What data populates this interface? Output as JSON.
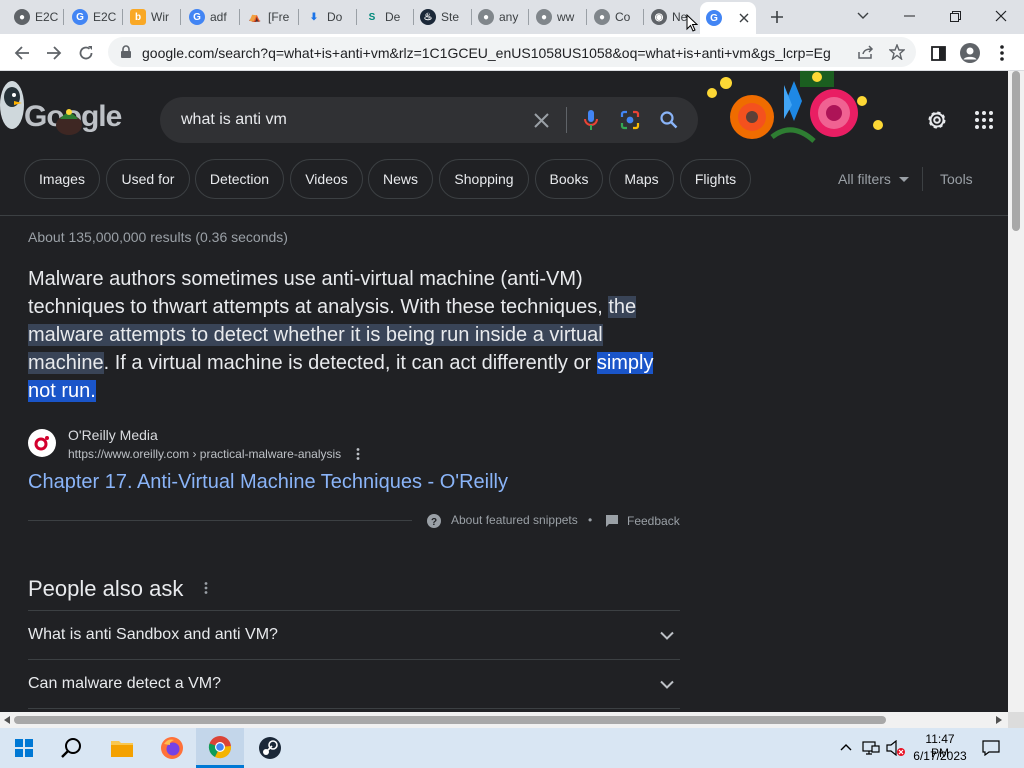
{
  "tabs": [
    {
      "label": "E2C",
      "color": "#5f6368"
    },
    {
      "label": "E2C",
      "color": "#4285f4"
    },
    {
      "label": "Wir",
      "color": "#f9a825"
    },
    {
      "label": "adf",
      "color": "#4285f4"
    },
    {
      "label": "[Fre",
      "color": "#202124"
    },
    {
      "label": "Do",
      "color": "#1a73e8"
    },
    {
      "label": "De",
      "color": "#00897b"
    },
    {
      "label": "Ste",
      "color": "#1b2838"
    },
    {
      "label": "any",
      "color": "#80868b"
    },
    {
      "label": "ww",
      "color": "#80868b"
    },
    {
      "label": "Co",
      "color": "#80868b"
    },
    {
      "label": "Ne",
      "color": "#5f6368"
    },
    {
      "label": "",
      "color": "#4285f4"
    }
  ],
  "browser": {
    "url": "google.com/search?q=what+is+anti+vm&rlz=1C1GCEU_enUS1058US1058&oq=what+is+anti+vm&gs_lcrp=Eg..."
  },
  "search": {
    "query": "what is anti vm",
    "logo": "Google"
  },
  "chips": [
    "Images",
    "Used for",
    "Detection",
    "Videos",
    "News",
    "Shopping",
    "Books",
    "Maps",
    "Flights"
  ],
  "tools": {
    "all_filters": "All filters",
    "tools": "Tools"
  },
  "result_stats": "About 135,000,000 results (0.36 seconds)",
  "snippet": {
    "part1": "Malware authors sometimes use anti-virtual machine (anti-VM) techniques to thwart attempts at analysis. With these techniques, ",
    "highlight": "the malware attempts to detect whether it is being run inside a virtual machine",
    "part2": ". If a virtual machine is detected, it can act differently or ",
    "selected": "simply not run."
  },
  "source": {
    "site": "O'Reilly Media",
    "breadcrumb": "https://www.oreilly.com › practical-malware-analysis",
    "title": "Chapter 17. Anti-Virtual Machine Techniques - O'Reilly"
  },
  "snippet_footer": {
    "about": "About featured snippets",
    "sep": "•",
    "feedback": "Feedback"
  },
  "people_also_ask": {
    "heading": "People also ask",
    "questions": [
      "What is anti Sandbox and anti VM?",
      "Can malware detect a VM?"
    ]
  },
  "clock": {
    "time": "11:47 PM",
    "date": "6/17/2023"
  },
  "colors": {
    "accent_link": "#8ab4f8",
    "page_bg": "#202124",
    "selection": "#1a55c9"
  }
}
